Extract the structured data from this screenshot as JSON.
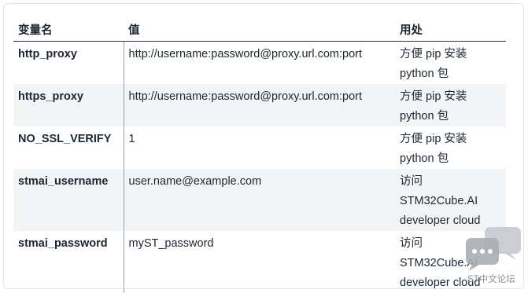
{
  "table": {
    "headers": [
      "变量名",
      "值",
      "用处"
    ],
    "rows": [
      {
        "name": "http_proxy",
        "value": "http://username:password@proxy.url.com:port",
        "use": [
          "方便 pip 安装",
          "python 包"
        ]
      },
      {
        "name": "https_proxy",
        "value": "http://username:password@proxy.url.com:port",
        "use": [
          "方便 pip 安装",
          "python 包"
        ]
      },
      {
        "name": "NO_SSL_VERIFY",
        "value": "1",
        "use": [
          "方便 pip 安装",
          "python 包"
        ]
      },
      {
        "name": "stmai_username",
        "value": "user.name@example.com",
        "use": [
          "访问",
          "STM32Cube.AI",
          "developer cloud"
        ]
      },
      {
        "name": "stmai_password",
        "value": "myST_password",
        "use": [
          "访问",
          "STM32Cube.AI",
          "developer cloud"
        ]
      }
    ]
  },
  "watermark": {
    "icon": "chat-bubbles-icon",
    "text": "ST中文论坛"
  }
}
